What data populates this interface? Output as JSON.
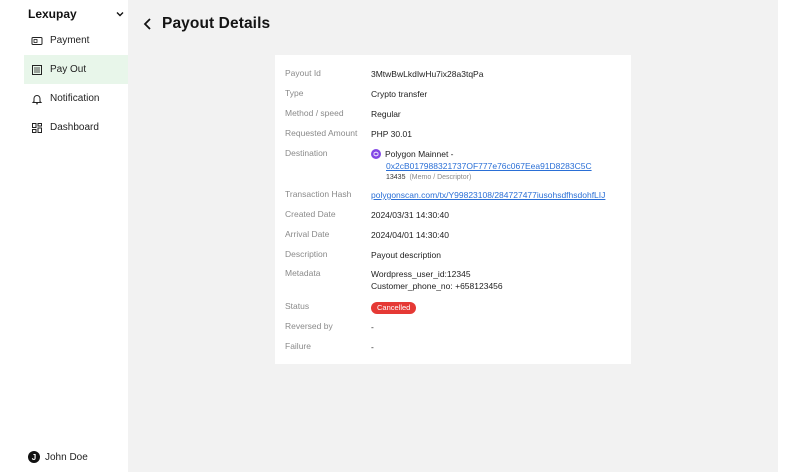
{
  "sidebar": {
    "brand": "Lexupay",
    "items": [
      {
        "label": "Payment",
        "icon": "payment-icon"
      },
      {
        "label": "Pay Out",
        "icon": "payout-icon",
        "active": true
      },
      {
        "label": "Notification",
        "icon": "bell-icon"
      },
      {
        "label": "Dashboard",
        "icon": "dashboard-icon"
      }
    ],
    "user": {
      "initial": "J",
      "name": "John Doe"
    }
  },
  "header": {
    "title": "Payout Details"
  },
  "details": {
    "payout_id": {
      "label": "Payout Id",
      "value": "3MtwBwLkdIwHu7ix28a3tqPa"
    },
    "type": {
      "label": "Type",
      "value": "Crypto transfer"
    },
    "method": {
      "label": "Method / speed",
      "value": "Regular"
    },
    "amount": {
      "label": "Requested Amount",
      "value": "PHP 30.01"
    },
    "destination": {
      "label": "Destination",
      "network": "Polygon Mainnet -",
      "address": "0x2cB017988321737OF777e76c067Eea91D8283C5C",
      "memo": "13435",
      "memo_note": "(Memo / Descriptor)"
    },
    "tx_hash": {
      "label": "Transaction Hash",
      "value": "polygonscan.com/tx/Y99823108/284727477iusohsdfhsdohfLIJ"
    },
    "created": {
      "label": "Created Date",
      "value": "2024/03/31 14:30:40"
    },
    "arrival": {
      "label": "Arrival Date",
      "value": "2024/04/01 14:30:40"
    },
    "description": {
      "label": "Description",
      "value": "Payout description"
    },
    "metadata": {
      "label": "Metadata",
      "line1": "Wordpress_user_id:12345",
      "line2": "Customer_phone_no: +658123456"
    },
    "status": {
      "label": "Status",
      "value": "Cancelled",
      "color": "#e53935"
    },
    "reversed": {
      "label": "Reversed by",
      "value": "-"
    },
    "failure": {
      "label": "Failure",
      "value": "-"
    }
  }
}
